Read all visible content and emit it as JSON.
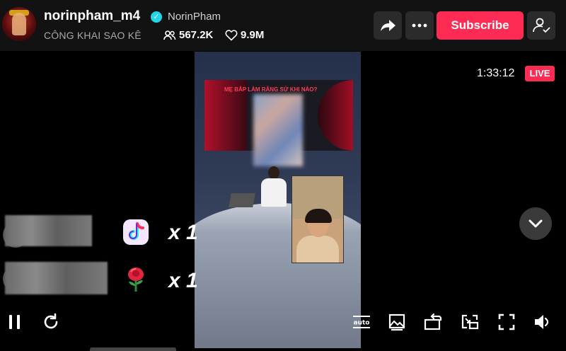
{
  "header": {
    "username": "norinpham_m4",
    "nickname": "NorinPham",
    "subtitle": "CÔNG KHAI SAO KÊ",
    "viewers": "567.2K",
    "likes": "9.9M",
    "subscribe_label": "Subscribe"
  },
  "video": {
    "screen_title": "MẸ BẮP LÀM RĂNG SỨ KHI NÀO?"
  },
  "status": {
    "elapsed": "1:33:12",
    "live_label": "LIVE"
  },
  "gifts": [
    {
      "icon": "tiktok-note-gift-icon",
      "count": "x 1"
    },
    {
      "icon": "rose-gift-icon",
      "count": "x 1"
    }
  ],
  "colors": {
    "accent": "#fe2c55",
    "verified": "#20d5ec",
    "header_bg": "#121212"
  },
  "icons": {
    "share": "share-icon",
    "more": "more-icon",
    "profile": "profile-check-icon",
    "scroll": "chevron-down-icon",
    "pause": "pause-icon",
    "refresh": "refresh-icon",
    "quality": "auto-quality-icon",
    "image": "image-icon",
    "rotate": "rotate-icon",
    "pip": "picture-in-picture-icon",
    "fullscreen": "fullscreen-icon",
    "volume": "volume-icon"
  }
}
